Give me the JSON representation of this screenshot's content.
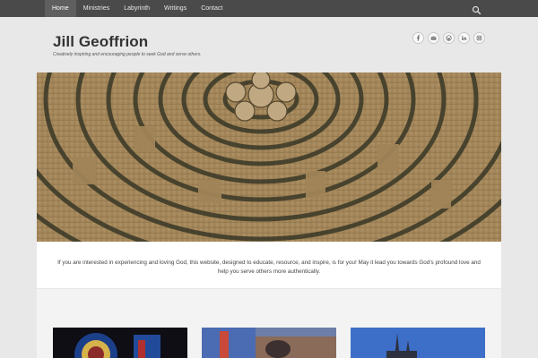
{
  "nav": {
    "items": [
      {
        "label": "Home",
        "active": true
      },
      {
        "label": "Ministries",
        "active": false
      },
      {
        "label": "Labyrinth",
        "active": false
      },
      {
        "label": "Writings",
        "active": false
      },
      {
        "label": "Contact",
        "active": false
      }
    ],
    "search_icon": "search-icon"
  },
  "site": {
    "title": "Jill Geoffrion",
    "tagline": "Creatively inspiring and encouraging people to seek God and serve others."
  },
  "social": [
    "facebook-icon",
    "email-icon",
    "wordpress-icon",
    "linkedin-icon",
    "instagram-icon"
  ],
  "hero": {
    "image": "labyrinth-photo"
  },
  "intro": "If you are interested in experiencing and loving God, this website, designed to educate, resource, and inspire, is for you! May it lead you towards God’s profound love and help you serve others more authentically.",
  "thumbnails": [
    "stained-glass-photo",
    "stained-glass-window-photo",
    "cathedral-spires-photo"
  ],
  "colors": {
    "topbar": "#4a4a4a",
    "nav_active": "#5f5f5f",
    "page_bg": "#e8e8e8",
    "title": "#333333"
  }
}
